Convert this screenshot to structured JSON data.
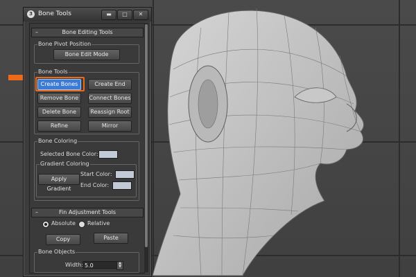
{
  "window": {
    "title": "Bone Tools",
    "app_icon": "3ds-max-logo-icon",
    "controls": {
      "minimize": "▬",
      "maximize": "□",
      "close": "✕"
    }
  },
  "bone_editing": {
    "rollout_sign": "–",
    "rollout_title": "Bone Editing Tools",
    "pivot_group": "Bone Pivot Position",
    "edit_mode": "Bone Edit Mode",
    "tools_group": "Bone Tools",
    "buttons": {
      "create_bones": "Create Bones",
      "create_end": "Create End",
      "remove_bone": "Remove Bone",
      "connect_bones": "Connect Bones",
      "delete_bone": "Delete Bone",
      "reassign_root": "Reassign Root",
      "refine": "Refine",
      "mirror": "Mirror"
    },
    "coloring_group": "Bone Coloring",
    "selected_color_label": "Selected Bone Color:",
    "gradient_group": "Gradient Coloring",
    "apply_gradient": "Apply Gradient",
    "start_color_label": "Start Color:",
    "end_color_label": "End Color:"
  },
  "fin": {
    "rollout_sign": "–",
    "rollout_title": "Fin Adjustment Tools",
    "absolute": "Absolute",
    "relative": "Relative",
    "copy": "Copy",
    "paste": "Paste",
    "objects_group": "Bone Objects",
    "width_label": "Width:",
    "width_value": "5.0"
  },
  "colors": {
    "highlight": "#ee6a1b",
    "active_button": "#3b7bd6",
    "swatch": "#c2cad8",
    "viewport_bg": "#454545"
  }
}
